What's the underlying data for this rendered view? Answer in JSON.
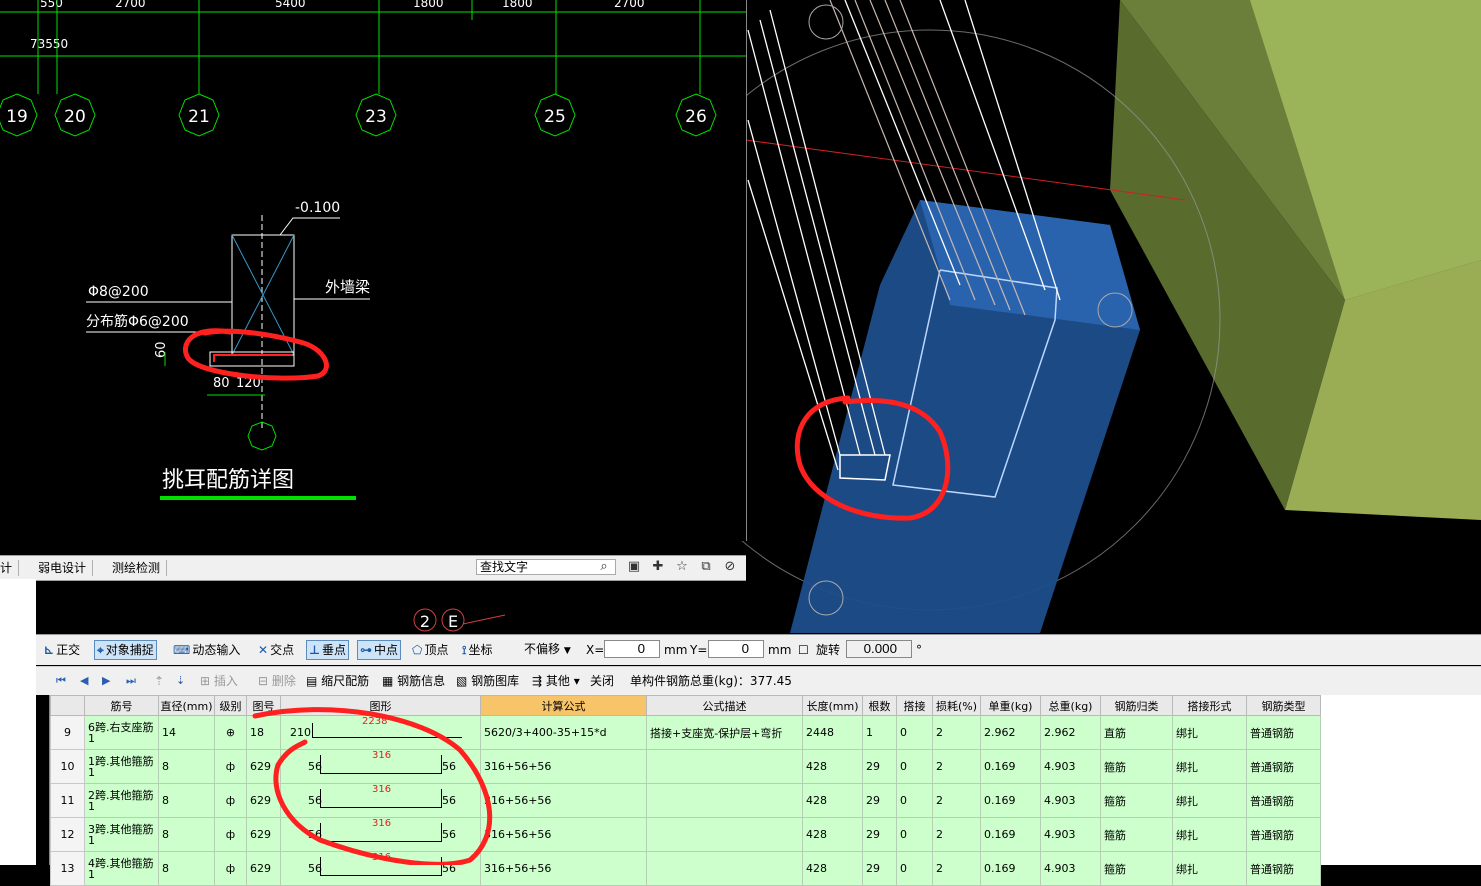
{
  "cad": {
    "top_dims": [
      "550",
      "2700",
      "5400",
      "1800",
      "1800",
      "2700"
    ],
    "total_dim": "73550",
    "axes": [
      "19",
      "20",
      "21",
      "23",
      "25",
      "26"
    ],
    "level": "-0.100",
    "beam_label": "外墙梁",
    "rebar_main": "Φ8@200",
    "rebar_dist": "分布筋Φ6@200",
    "dim_h": "60",
    "dim_w1": "80",
    "dim_w2": "120",
    "detail_title": "挑耳配筋详图",
    "bottom_axis_labels": [
      "2",
      "E"
    ]
  },
  "cadbar": {
    "tab_partial": "计",
    "tab1": "弱电设计",
    "tab2": "测绘检测",
    "search_value": "查找文字"
  },
  "snapbar": {
    "ortho": "正交",
    "snap": "对象捕捉",
    "dyn": "动态输入",
    "inter": "交点",
    "perp": "垂点",
    "mid": "中点",
    "vertex": "顶点",
    "coord": "坐标",
    "offset_mode": "不偏移",
    "x_label": "X=",
    "x_value": "0",
    "y_label": "Y=",
    "y_value": "0",
    "unit": "mm",
    "rotate": "旋转",
    "rotate_value": "0.000",
    "degree": "°"
  },
  "toolbar2": {
    "insert": "插入",
    "delete": "删除",
    "scale_rebar": "缩尺配筋",
    "rebar_info": "钢筋信息",
    "rebar_lib": "钢筋图库",
    "other": "其他",
    "close": "关闭",
    "total_weight": "单构件钢筋总重(kg)：377.45"
  },
  "table": {
    "headers": [
      "筋号",
      "直径(mm)",
      "级别",
      "图号",
      "图形",
      "计算公式",
      "公式描述",
      "长度(mm)",
      "根数",
      "搭接",
      "损耗(%)",
      "单重(kg)",
      "总重(kg)",
      "钢筋归类",
      "搭接形式",
      "钢筋类型"
    ],
    "rows": [
      {
        "no": "9",
        "name": "6跨.右支座筋1",
        "dia": "14",
        "grade": "⊕",
        "fig": "18",
        "shape_left": "210",
        "shape_top": "2238",
        "shape_right": "",
        "formula": "5620/3+400-35+15*d",
        "desc": "搭接+支座宽-保护层+弯折",
        "len": "2448",
        "count": "1",
        "lap": "0",
        "loss": "2",
        "unit_w": "2.962",
        "total_w": "2.962",
        "cls": "直筋",
        "lap_type": "绑扎",
        "type": "普通钢筋"
      },
      {
        "no": "10",
        "name": "1跨.其他箍筋1",
        "dia": "8",
        "grade": "ф",
        "fig": "629",
        "shape_left": "56",
        "shape_top": "316",
        "shape_right": "56",
        "formula": "316+56+56",
        "desc": "",
        "len": "428",
        "count": "29",
        "lap": "0",
        "loss": "2",
        "unit_w": "0.169",
        "total_w": "4.903",
        "cls": "箍筋",
        "lap_type": "绑扎",
        "type": "普通钢筋"
      },
      {
        "no": "11",
        "name": "2跨.其他箍筋1",
        "dia": "8",
        "grade": "ф",
        "fig": "629",
        "shape_left": "56",
        "shape_top": "316",
        "shape_right": "56",
        "formula": "316+56+56",
        "desc": "",
        "len": "428",
        "count": "29",
        "lap": "0",
        "loss": "2",
        "unit_w": "0.169",
        "total_w": "4.903",
        "cls": "箍筋",
        "lap_type": "绑扎",
        "type": "普通钢筋"
      },
      {
        "no": "12",
        "name": "3跨.其他箍筋1",
        "dia": "8",
        "grade": "ф",
        "fig": "629",
        "shape_left": "56",
        "shape_top": "316",
        "shape_right": "56",
        "formula": "316+56+56",
        "desc": "",
        "len": "428",
        "count": "29",
        "lap": "0",
        "loss": "2",
        "unit_w": "0.169",
        "total_w": "4.903",
        "cls": "箍筋",
        "lap_type": "绑扎",
        "type": "普通钢筋"
      },
      {
        "no": "13",
        "name": "4跨.其他箍筋1",
        "dia": "8",
        "grade": "ф",
        "fig": "629",
        "shape_left": "56",
        "shape_top": "316",
        "shape_right": "56",
        "formula": "316+56+56",
        "desc": "",
        "len": "428",
        "count": "29",
        "lap": "0",
        "loss": "2",
        "unit_w": "0.169",
        "total_w": "4.903",
        "cls": "箍筋",
        "lap_type": "绑扎",
        "type": "普通钢筋"
      }
    ]
  }
}
